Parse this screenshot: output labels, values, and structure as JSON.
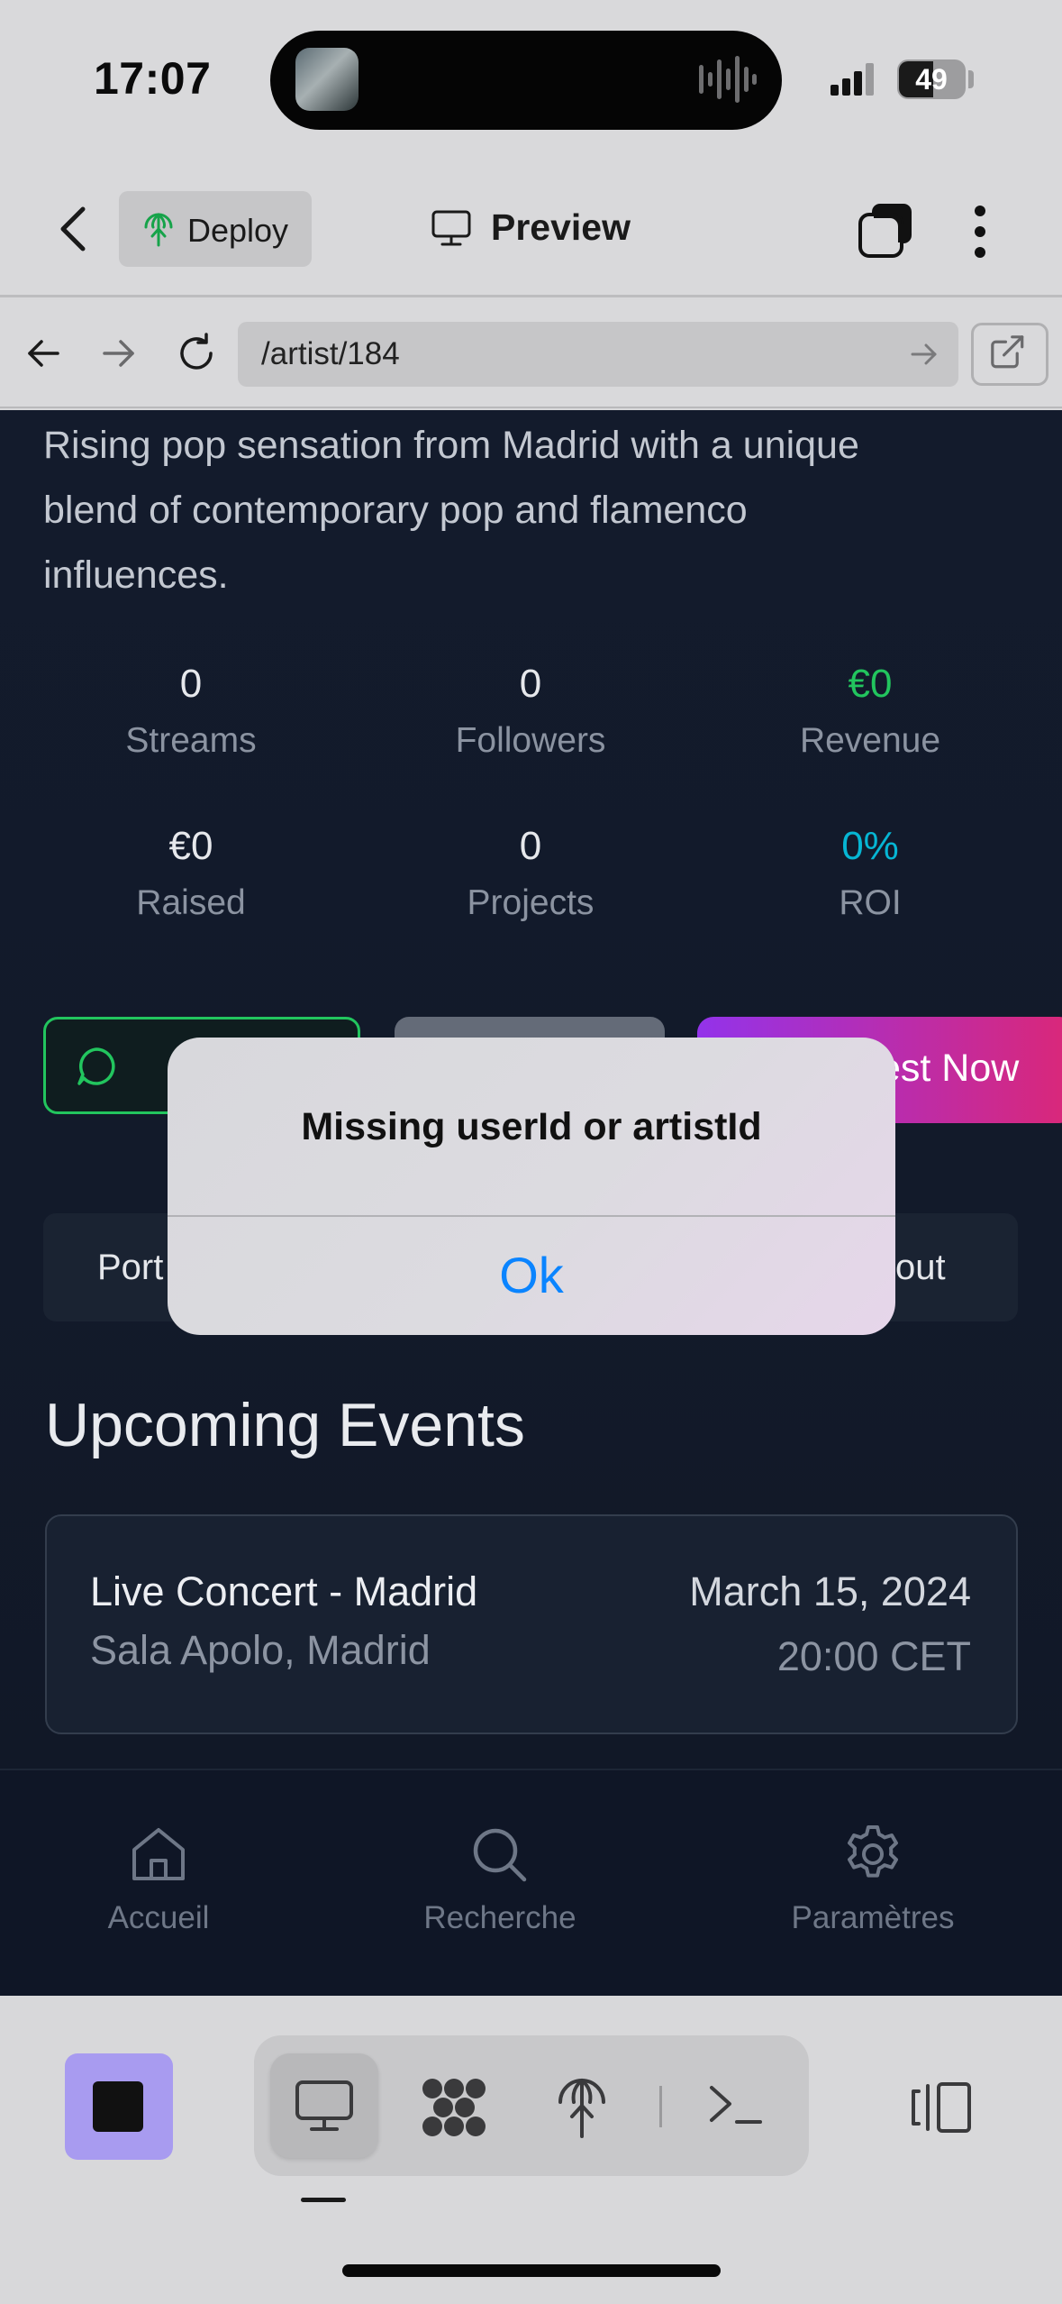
{
  "status": {
    "time": "17:07",
    "battery": "49"
  },
  "toolbar": {
    "deploy_label": "Deploy",
    "preview_label": "Preview"
  },
  "urlbar": {
    "url": "/artist/184"
  },
  "artist": {
    "bio_lines": [
      "Rising pop sensation from Madrid with a unique",
      "blend of contemporary pop and flamenco",
      "influences."
    ],
    "stats": [
      {
        "value": "0",
        "label": "Streams"
      },
      {
        "value": "0",
        "label": "Followers"
      },
      {
        "value": "€0",
        "label": "Revenue"
      },
      {
        "value": "€0",
        "label": "Raised"
      },
      {
        "value": "0",
        "label": "Projects"
      },
      {
        "value": "0%",
        "label": "ROI"
      }
    ],
    "invest_label_visible": "est Now",
    "tabs_visible": {
      "left": "Port",
      "right": "out"
    }
  },
  "events": {
    "title": "Upcoming Events",
    "items": [
      {
        "name": "Live Concert - Madrid",
        "venue": "Sala Apolo, Madrid",
        "date": "March 15, 2024",
        "time": "20:00 CET"
      }
    ]
  },
  "nav": {
    "home": "Accueil",
    "search": "Recherche",
    "settings": "Paramètres"
  },
  "dialog": {
    "message": "Missing userId or artistId",
    "ok_label": "Ok"
  },
  "colors": {
    "green": "#22c55e",
    "cyan": "#06b6d4",
    "ios_blue": "#0a84ff",
    "stop_purple": "#a89bf0"
  }
}
